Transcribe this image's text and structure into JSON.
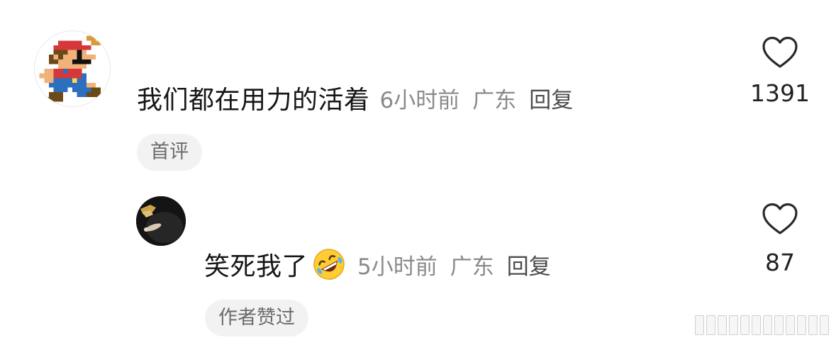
{
  "comments": [
    {
      "text": "我们都在用力的活着",
      "time": "6小时前",
      "location": "广东",
      "reply_label": "回复",
      "tag": "首评",
      "likes": "1391",
      "avatar_icon": "pixel-mario-icon"
    },
    {
      "text": "笑死我了",
      "emoji_icon": "rolling-on-floor-laughing-emoji-icon",
      "time": "5小时前",
      "location": "广东",
      "reply_label": "回复",
      "tag": "作者赞过",
      "likes": "87",
      "avatar_icon": "dark-photo-avatar-icon"
    }
  ],
  "colors": {
    "primary_text": "#161616",
    "meta_text": "#8a8a8a",
    "tag_background": "#f2f2f2",
    "tag_text": "#6b6b6b"
  }
}
